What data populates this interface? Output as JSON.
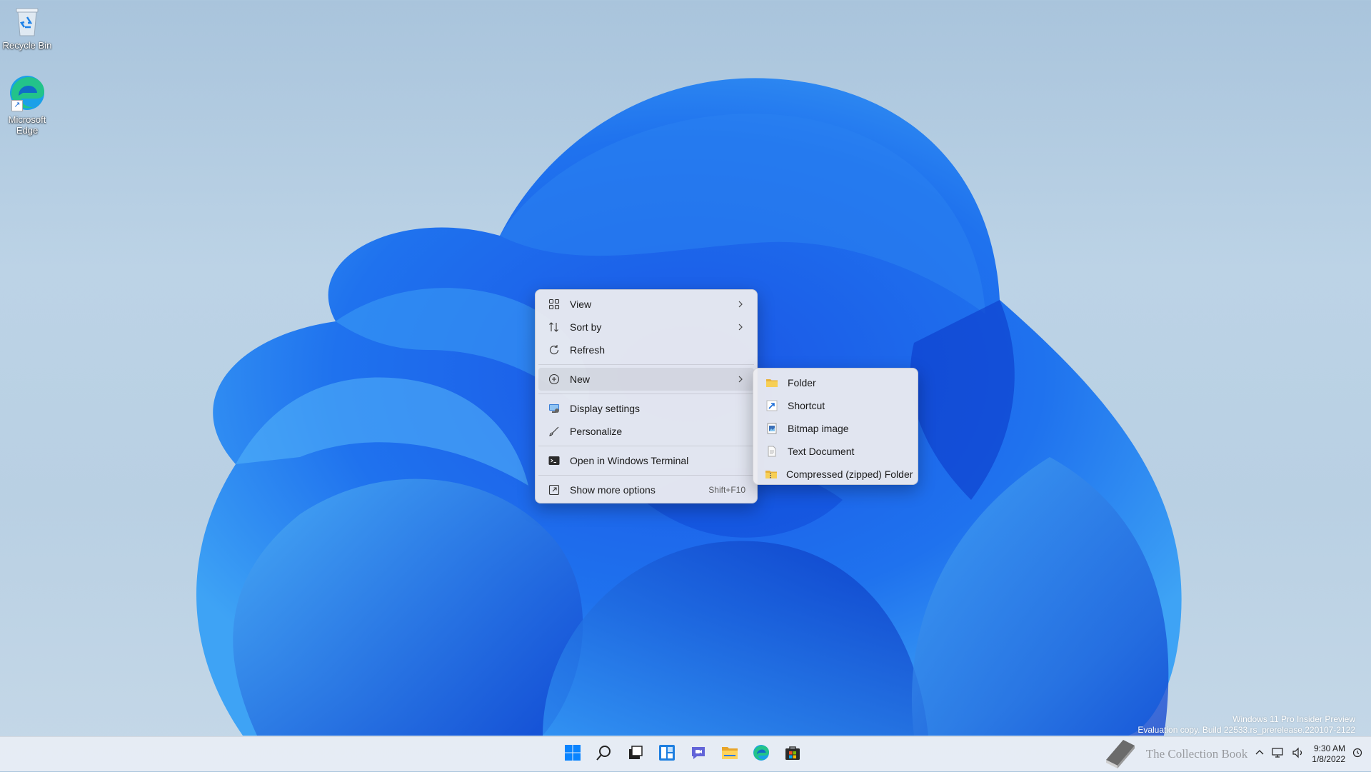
{
  "desktop": {
    "icons": [
      {
        "label": "Recycle Bin",
        "icon": "recycle-bin-icon"
      },
      {
        "label": "Microsoft Edge",
        "icon": "edge-icon"
      }
    ],
    "watermark": {
      "line1": "Windows 11 Pro Insider Preview",
      "line2": "Evaluation copy. Build 22533.rs_prerelease.220107-2122"
    }
  },
  "context_menu": {
    "items": [
      {
        "label": "View",
        "icon": "view-grid-icon",
        "submenu": true
      },
      {
        "label": "Sort by",
        "icon": "sort-icon",
        "submenu": true
      },
      {
        "label": "Refresh",
        "icon": "refresh-icon"
      },
      {
        "label": "New",
        "icon": "new-plus-icon",
        "submenu": true,
        "highlighted": true
      },
      {
        "label": "Display settings",
        "icon": "display-settings-icon"
      },
      {
        "label": "Personalize",
        "icon": "personalize-brush-icon"
      },
      {
        "label": "Open in Windows Terminal",
        "icon": "terminal-icon"
      },
      {
        "label": "Show more options",
        "icon": "more-options-icon",
        "shortcut": "Shift+F10"
      }
    ]
  },
  "new_submenu": {
    "items": [
      {
        "label": "Folder",
        "icon": "folder-icon"
      },
      {
        "label": "Shortcut",
        "icon": "shortcut-icon"
      },
      {
        "label": "Bitmap image",
        "icon": "bitmap-image-icon"
      },
      {
        "label": "Text Document",
        "icon": "text-document-icon"
      },
      {
        "label": "Compressed (zipped) Folder",
        "icon": "zip-folder-icon"
      }
    ]
  },
  "taskbar": {
    "apps": [
      "start-icon",
      "search-icon",
      "task-view-icon",
      "widgets-icon",
      "chat-icon",
      "file-explorer-icon",
      "edge-icon",
      "store-icon"
    ],
    "clock": {
      "time": "9:30 AM",
      "date": "1/8/2022"
    },
    "overlay_text": "The Collection Book"
  },
  "colors": {
    "accent": "#0067c0",
    "bloom_dark": "#0a3fd1",
    "bloom_light": "#2e8ff0"
  }
}
